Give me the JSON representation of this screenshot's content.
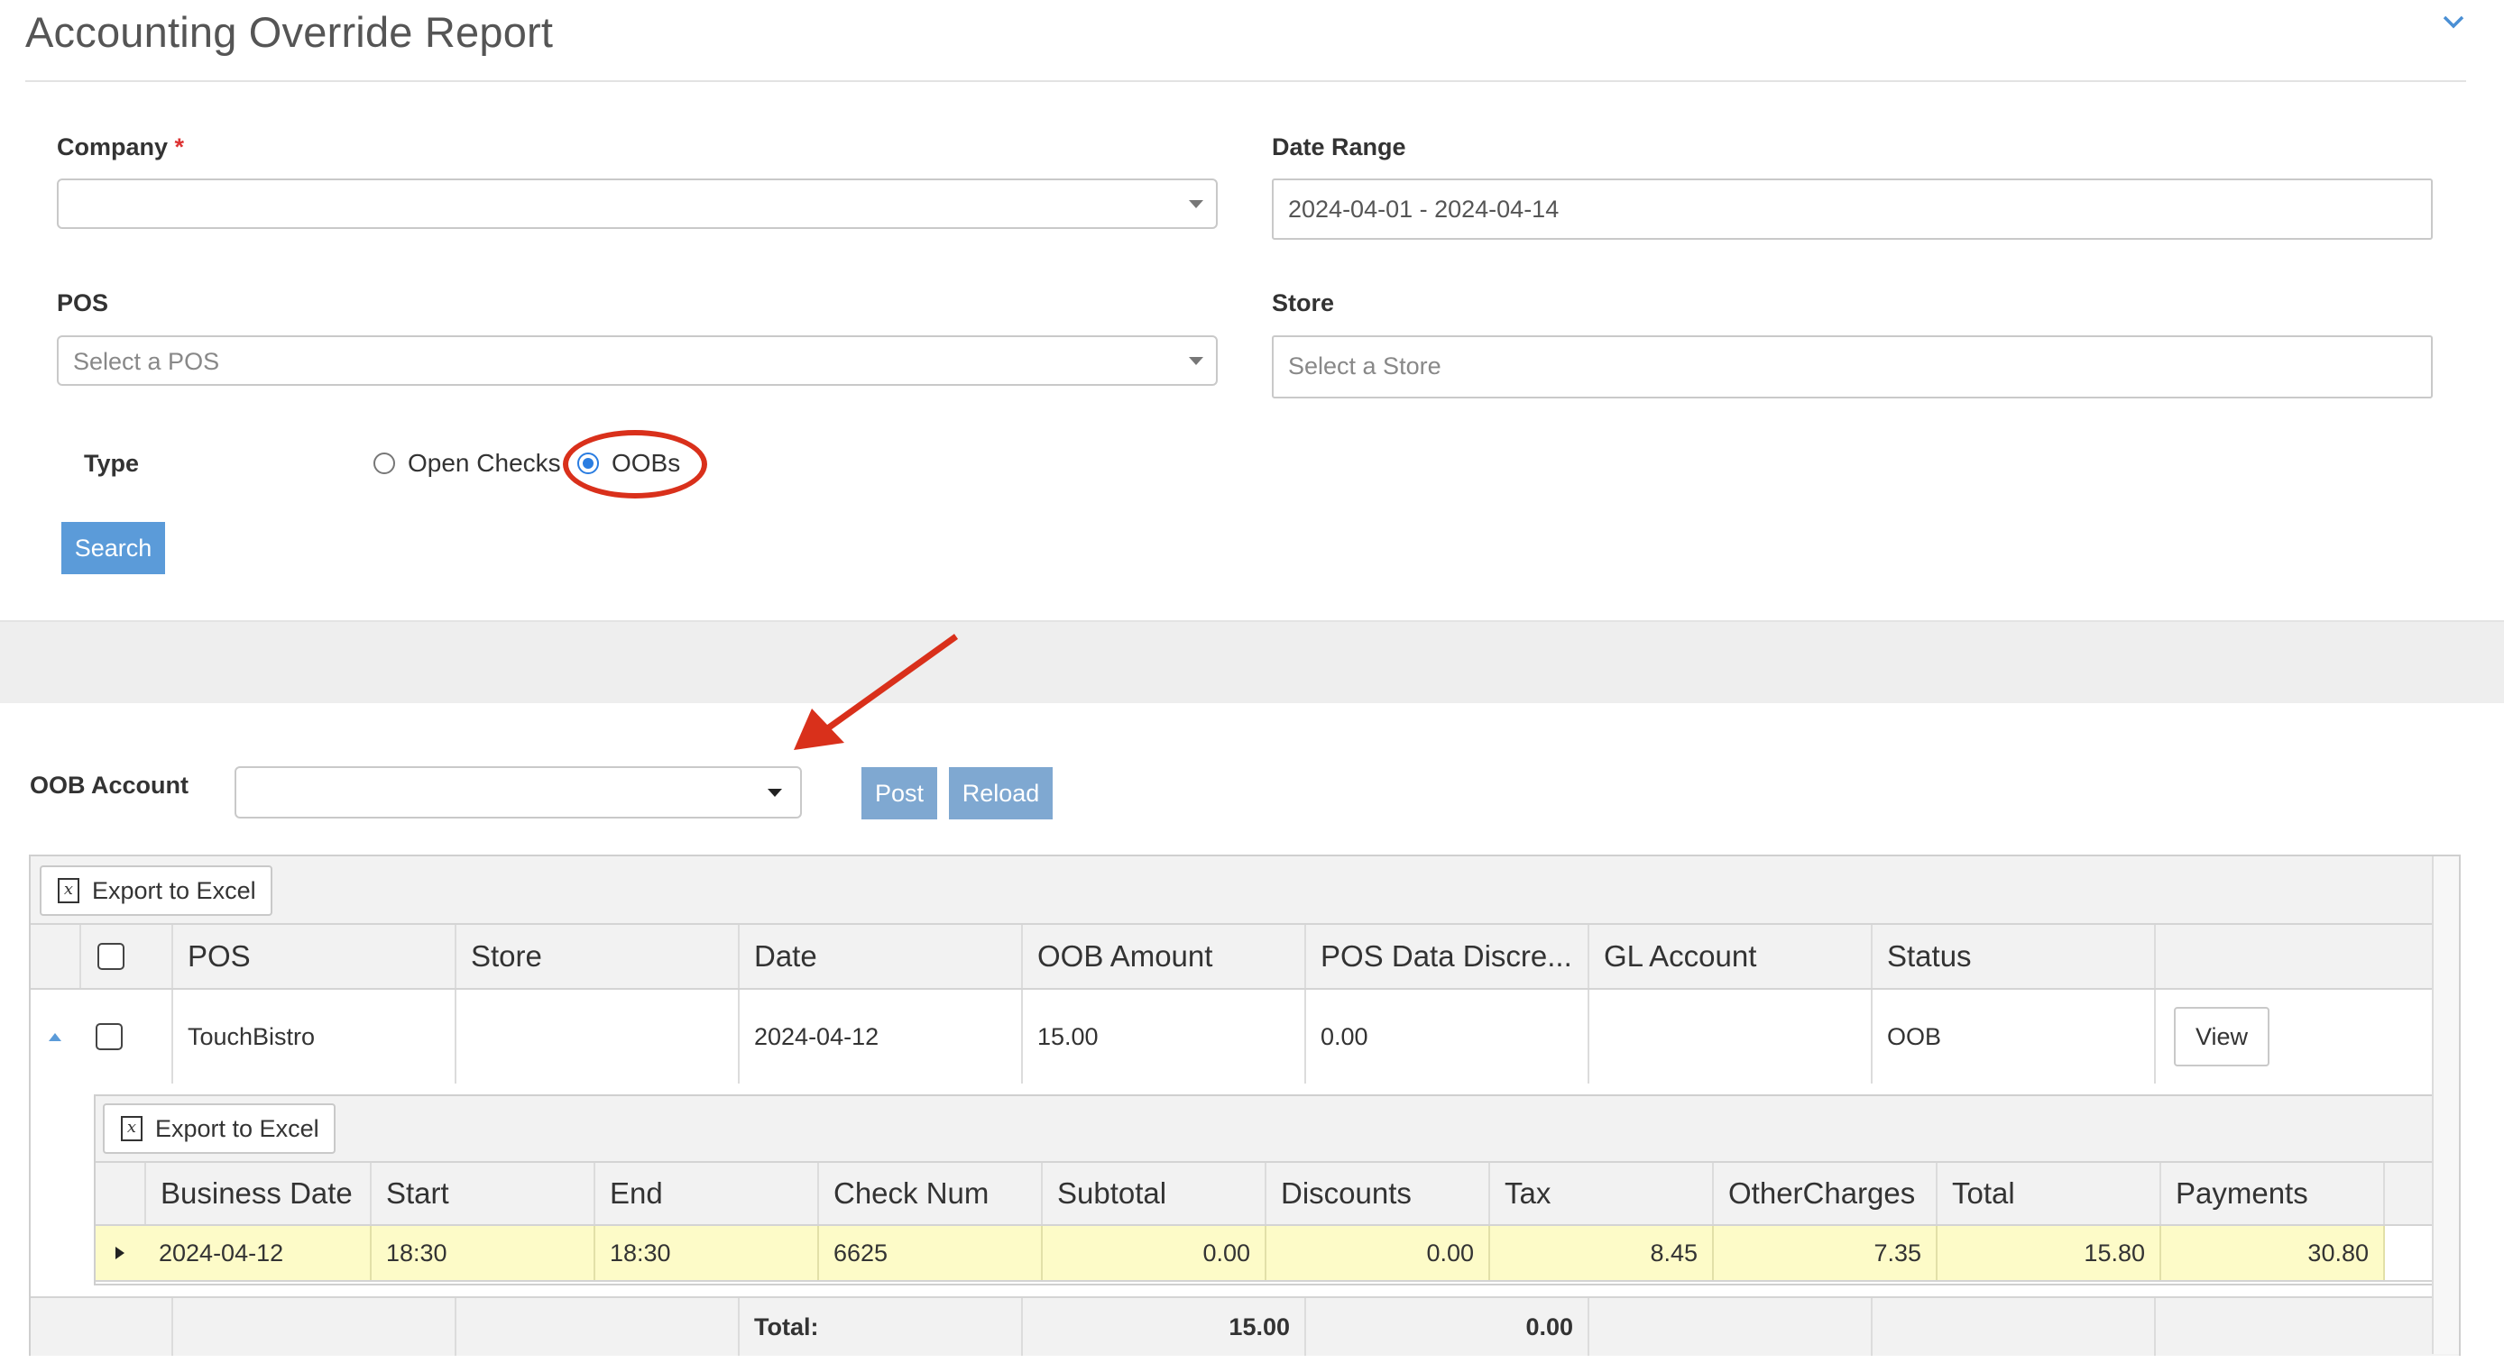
{
  "page": {
    "title": "Accounting Override Report"
  },
  "filters": {
    "company_label": "Company",
    "company_required": "*",
    "company_value": "",
    "date_range_label": "Date Range",
    "date_range_value": "2024-04-01 - 2024-04-14",
    "pos_label": "POS",
    "pos_placeholder": "Select a POS",
    "store_label": "Store",
    "store_placeholder": "Select a Store",
    "type_label": "Type",
    "type_options": [
      {
        "label": "Open Checks",
        "selected": false
      },
      {
        "label": "OOBs",
        "selected": true
      }
    ],
    "search_label": "Search"
  },
  "oob": {
    "account_label": "OOB Account",
    "account_value": "",
    "post_label": "Post",
    "reload_label": "Reload"
  },
  "grid": {
    "export_label": "Export to Excel",
    "columns": [
      "POS",
      "Store",
      "Date",
      "OOB Amount",
      "POS Data Discre...",
      "GL Account",
      "Status"
    ],
    "rows": [
      {
        "pos": "TouchBistro",
        "store": "",
        "date": "2024-04-12",
        "oob_amount": "15.00",
        "pos_data_discrepancy": "0.00",
        "gl_account": "",
        "status": "OOB",
        "action_label": "View"
      }
    ],
    "detail": {
      "export_label": "Export to Excel",
      "columns": [
        "Business Date",
        "Start",
        "End",
        "Check Num",
        "Subtotal",
        "Discounts",
        "Tax",
        "OtherCharges",
        "Total",
        "Payments"
      ],
      "rows": [
        {
          "business_date": "2024-04-12",
          "start": "18:30",
          "end": "18:30",
          "check_num": "6625",
          "subtotal": "0.00",
          "discounts": "0.00",
          "tax": "8.45",
          "other_charges": "7.35",
          "total": "15.80",
          "payments": "30.80"
        }
      ]
    },
    "footer": {
      "total_label": "Total:",
      "oob_amount_total": "15.00",
      "pos_data_discrepancy_total": "0.00"
    }
  },
  "colors": {
    "accent": "#5b9bd9",
    "annotation_red": "#d9301b",
    "detail_row_highlight": "#fdfbc8"
  },
  "icons": {
    "collapse": "chevron-down-icon",
    "excel": "excel-icon",
    "row_expand": "triangle-up-icon",
    "detail_expand": "triangle-right-icon"
  }
}
